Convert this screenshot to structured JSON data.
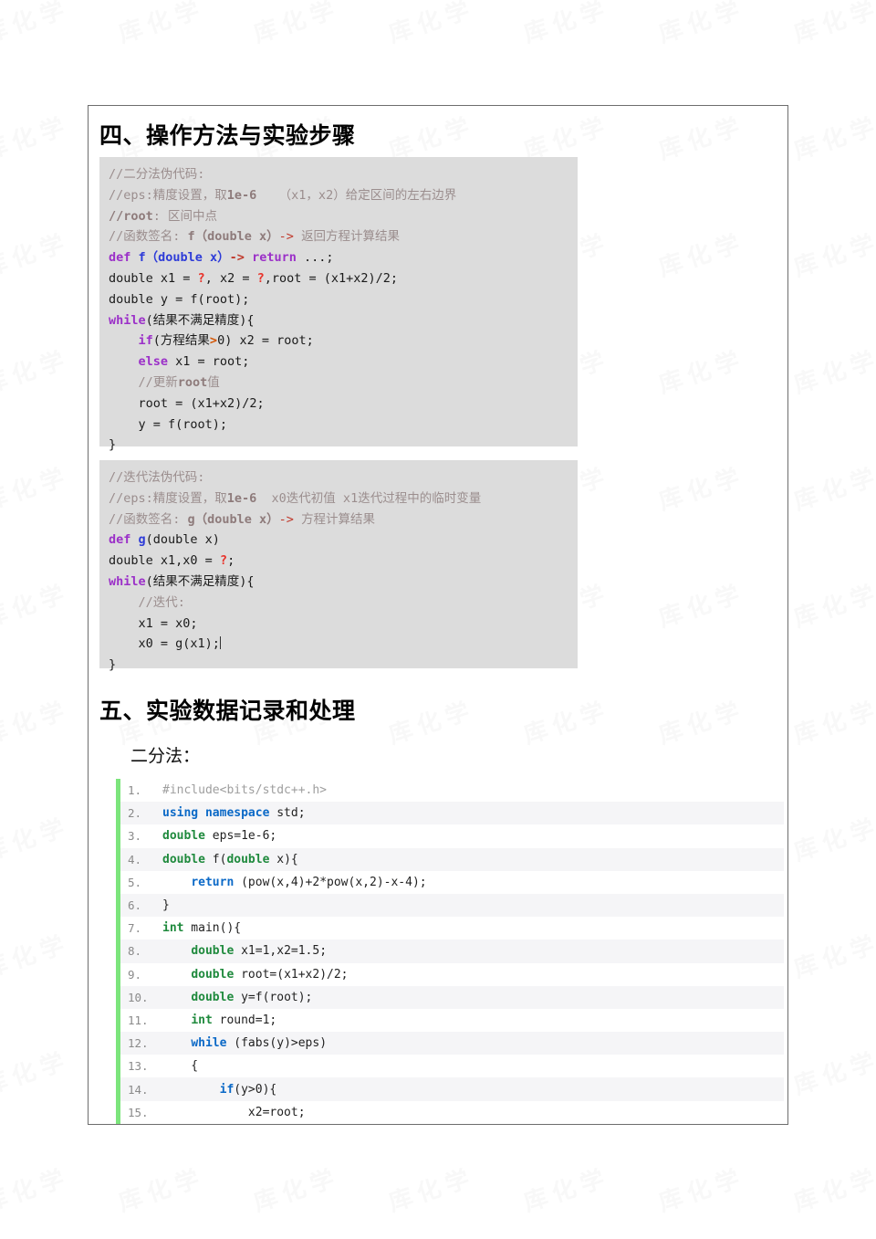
{
  "document": {
    "watermark_glyph": "库 化 学"
  },
  "sections": {
    "four": {
      "heading": "四、操作方法与实验步骤"
    },
    "five": {
      "heading": "五、实验数据记录和处理",
      "sub_label": "二分法："
    }
  },
  "pseudocode_bisection": {
    "title_comment": "//二分法伪代码:",
    "lines": [
      {
        "id": "p1-l1",
        "segments": [
          {
            "text": "//二分法伪代码:",
            "style": "comment"
          }
        ]
      },
      {
        "id": "p1-l2",
        "segments": [
          {
            "text": "//eps:精度设置，取",
            "style": "comment"
          },
          {
            "text": "1e-6",
            "style": "comment-b"
          },
          {
            "text": "   （x1，x2）给定区间的左右边界",
            "style": "comment"
          }
        ]
      },
      {
        "id": "p1-l3",
        "segments": [
          {
            "text": "//root",
            "style": "comment-b"
          },
          {
            "text": ": 区间中点",
            "style": "comment"
          }
        ]
      },
      {
        "id": "p1-l4",
        "segments": [
          {
            "text": "//函数签名: ",
            "style": "comment"
          },
          {
            "text": "f（double x）",
            "style": "comment-b"
          },
          {
            "text": "-> ",
            "style": "arrow"
          },
          {
            "text": "返回方程计算结果",
            "style": "comment"
          }
        ]
      },
      {
        "id": "p1-l5",
        "segments": [
          {
            "text": "def ",
            "style": "kw"
          },
          {
            "text": "f（double x）",
            "style": "fn"
          },
          {
            "text": "-> ",
            "style": "op"
          },
          {
            "text": "return",
            "style": "kw"
          },
          {
            "text": " ...;",
            "style": "plain"
          }
        ]
      },
      {
        "id": "p1-l6",
        "segments": [
          {
            "text": "double x1 = ",
            "style": "plain"
          },
          {
            "text": "?",
            "style": "q"
          },
          {
            "text": ", x2 = ",
            "style": "plain"
          },
          {
            "text": "?",
            "style": "q"
          },
          {
            "text": ",root = (x1+x2)/2;",
            "style": "plain"
          }
        ]
      },
      {
        "id": "p1-l7",
        "segments": [
          {
            "text": "double y = f(root);",
            "style": "plain"
          }
        ]
      },
      {
        "id": "p1-l8",
        "segments": [
          {
            "text": "while",
            "style": "kw"
          },
          {
            "text": "(结果不满足精度){",
            "style": "plain"
          }
        ]
      },
      {
        "id": "p1-l9",
        "segments": [
          {
            "text": "    ",
            "style": "plain"
          },
          {
            "text": "if",
            "style": "kw"
          },
          {
            "text": "(方程结果",
            "style": "plain"
          },
          {
            "text": ">",
            "style": "gt"
          },
          {
            "text": "0) x2 = root;",
            "style": "plain"
          }
        ]
      },
      {
        "id": "p1-l10",
        "segments": [
          {
            "text": "    ",
            "style": "plain"
          },
          {
            "text": "else",
            "style": "kw"
          },
          {
            "text": " x1 = root;",
            "style": "plain"
          }
        ]
      },
      {
        "id": "p1-l11",
        "segments": [
          {
            "text": "    //更新",
            "style": "comment"
          },
          {
            "text": "root",
            "style": "comment-b"
          },
          {
            "text": "值",
            "style": "comment"
          }
        ]
      },
      {
        "id": "p1-l12",
        "segments": [
          {
            "text": "    root = (x1+x2)/2;",
            "style": "plain"
          }
        ]
      },
      {
        "id": "p1-l13",
        "segments": [
          {
            "text": "    y = f(root);",
            "style": "plain"
          }
        ]
      },
      {
        "id": "p1-l14",
        "segments": [
          {
            "text": "}",
            "style": "plain"
          }
        ]
      }
    ]
  },
  "pseudocode_iteration": {
    "title_comment": "//迭代法伪代码:",
    "lines": [
      {
        "id": "p2-l1",
        "segments": [
          {
            "text": "//迭代法伪代码:",
            "style": "comment"
          }
        ]
      },
      {
        "id": "p2-l2",
        "segments": [
          {
            "text": "//eps:精度设置，取",
            "style": "comment"
          },
          {
            "text": "1e-6",
            "style": "comment-b"
          },
          {
            "text": "  x0迭代初值 x1迭代过程中的临时变量",
            "style": "comment"
          }
        ]
      },
      {
        "id": "p2-l3",
        "segments": [
          {
            "text": "//函数签名: ",
            "style": "comment"
          },
          {
            "text": "g（double x）",
            "style": "comment-b"
          },
          {
            "text": "-> ",
            "style": "arrow"
          },
          {
            "text": "方程计算结果",
            "style": "comment"
          }
        ]
      },
      {
        "id": "p2-l4",
        "segments": [
          {
            "text": "def ",
            "style": "kw"
          },
          {
            "text": "g",
            "style": "fn"
          },
          {
            "text": "(double x)",
            "style": "plain"
          }
        ]
      },
      {
        "id": "p2-l5",
        "segments": [
          {
            "text": "double x1,x0 = ",
            "style": "plain"
          },
          {
            "text": "?",
            "style": "q"
          },
          {
            "text": ";",
            "style": "plain"
          }
        ]
      },
      {
        "id": "p2-l6",
        "segments": [
          {
            "text": "while",
            "style": "kw"
          },
          {
            "text": "(结果不满足精度){",
            "style": "plain"
          }
        ]
      },
      {
        "id": "p2-l7",
        "segments": [
          {
            "text": "    //迭代:",
            "style": "comment"
          }
        ]
      },
      {
        "id": "p2-l8",
        "segments": [
          {
            "text": "    x1 = x0;",
            "style": "plain"
          }
        ]
      },
      {
        "id": "p2-l9",
        "segments": [
          {
            "text": "    x0 = g(x1);",
            "style": "plain"
          },
          {
            "text": "",
            "style": "caret"
          }
        ]
      },
      {
        "id": "p2-l10",
        "segments": [
          {
            "text": "}",
            "style": "plain"
          }
        ]
      }
    ]
  },
  "code_listing": {
    "language": "cpp",
    "lines": [
      {
        "num": "1.",
        "segments": [
          {
            "text": "#include<bits/stdc++.h>",
            "style": "pre"
          }
        ]
      },
      {
        "num": "2.",
        "segments": [
          {
            "text": "using namespace",
            "style": "kw"
          },
          {
            "text": " std;",
            "style": "txt"
          }
        ]
      },
      {
        "num": "3.",
        "segments": [
          {
            "text": "double",
            "style": "type"
          },
          {
            "text": " eps=1e-6;",
            "style": "txt"
          }
        ]
      },
      {
        "num": "4.",
        "segments": [
          {
            "text": "double",
            "style": "type"
          },
          {
            "text": " f(",
            "style": "txt"
          },
          {
            "text": "double",
            "style": "type"
          },
          {
            "text": " x){",
            "style": "txt"
          }
        ]
      },
      {
        "num": "5.",
        "segments": [
          {
            "text": "    ",
            "style": "txt"
          },
          {
            "text": "return",
            "style": "kw"
          },
          {
            "text": " (pow(x,4)+2*pow(x,2)-x-4);",
            "style": "txt"
          }
        ]
      },
      {
        "num": "6.",
        "segments": [
          {
            "text": "}",
            "style": "txt"
          }
        ]
      },
      {
        "num": "7.",
        "segments": [
          {
            "text": "int",
            "style": "type"
          },
          {
            "text": " main(){",
            "style": "txt"
          }
        ]
      },
      {
        "num": "8.",
        "segments": [
          {
            "text": "    ",
            "style": "txt"
          },
          {
            "text": "double",
            "style": "type"
          },
          {
            "text": " x1=1,x2=1.5;",
            "style": "txt"
          }
        ]
      },
      {
        "num": "9.",
        "segments": [
          {
            "text": "    ",
            "style": "txt"
          },
          {
            "text": "double",
            "style": "type"
          },
          {
            "text": " root=(x1+x2)/2;",
            "style": "txt"
          }
        ]
      },
      {
        "num": "10.",
        "segments": [
          {
            "text": "    ",
            "style": "txt"
          },
          {
            "text": "double",
            "style": "type"
          },
          {
            "text": " y=f(root);",
            "style": "txt"
          }
        ]
      },
      {
        "num": "11.",
        "segments": [
          {
            "text": "    ",
            "style": "txt"
          },
          {
            "text": "int",
            "style": "type"
          },
          {
            "text": " round=1;",
            "style": "txt"
          }
        ]
      },
      {
        "num": "12.",
        "segments": [
          {
            "text": "    ",
            "style": "txt"
          },
          {
            "text": "while",
            "style": "kw"
          },
          {
            "text": " (fabs(y)>eps)",
            "style": "txt"
          }
        ]
      },
      {
        "num": "13.",
        "segments": [
          {
            "text": "    {",
            "style": "txt"
          }
        ]
      },
      {
        "num": "14.",
        "segments": [
          {
            "text": "        ",
            "style": "txt"
          },
          {
            "text": "if",
            "style": "kw"
          },
          {
            "text": "(y>0){",
            "style": "txt"
          }
        ]
      },
      {
        "num": "15.",
        "segments": [
          {
            "text": "            x2=root;",
            "style": "txt"
          }
        ]
      }
    ]
  }
}
